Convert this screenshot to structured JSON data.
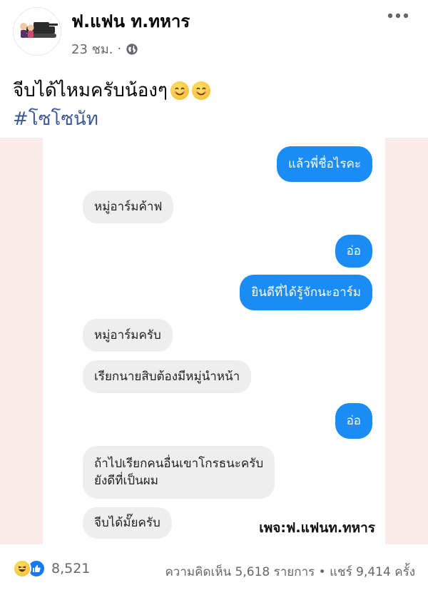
{
  "post": {
    "author": "ฟ.แฟน ท.ทหาร",
    "time": "23 ชม.",
    "dot": "·",
    "text": "จีบได้ไหมครับน้องๆ",
    "hashtag": "#โซโซนัท",
    "more_icon": "more-horizontal-icon",
    "privacy_icon": "globe-icon"
  },
  "chat": {
    "messages": [
      {
        "side": "sent",
        "text": "แล้วพี่ชื่อไรคะ"
      },
      {
        "side": "received",
        "text": "หมู่อาร์มค้าฟ"
      },
      {
        "side": "sent",
        "text": "อ่อ"
      },
      {
        "side": "sent",
        "text": "ยินดีที่ได้รู้จักนะอาร์ม"
      },
      {
        "side": "received",
        "text": "หมู่อาร์มครับ"
      },
      {
        "side": "received",
        "text": "เรียกนายสิบต้องมีหมู่นำหน้า"
      },
      {
        "side": "sent",
        "text": "อ่อ"
      },
      {
        "side": "received",
        "text": "ถ้าไปเรียกคนอื่นเขาโกรธนะครับ"
      },
      {
        "side": "received",
        "text": "ยังดีที่เป็นผม"
      },
      {
        "side": "received",
        "text": "จีบได้มั๊ยครับ"
      }
    ],
    "watermark": "เพจ:ฟ.แฟนท.ทหาร"
  },
  "footer": {
    "reaction_count": "8,521",
    "comments": "ความคิดเห็น 5,618 รายการ",
    "separator": "•",
    "shares": "แชร์ 9,414 ครั้ง"
  },
  "colors": {
    "sent_bubble": "#1b8cf5",
    "received_bubble": "#eeeeee",
    "hashtag": "#385898",
    "meta_text": "#65676b"
  }
}
